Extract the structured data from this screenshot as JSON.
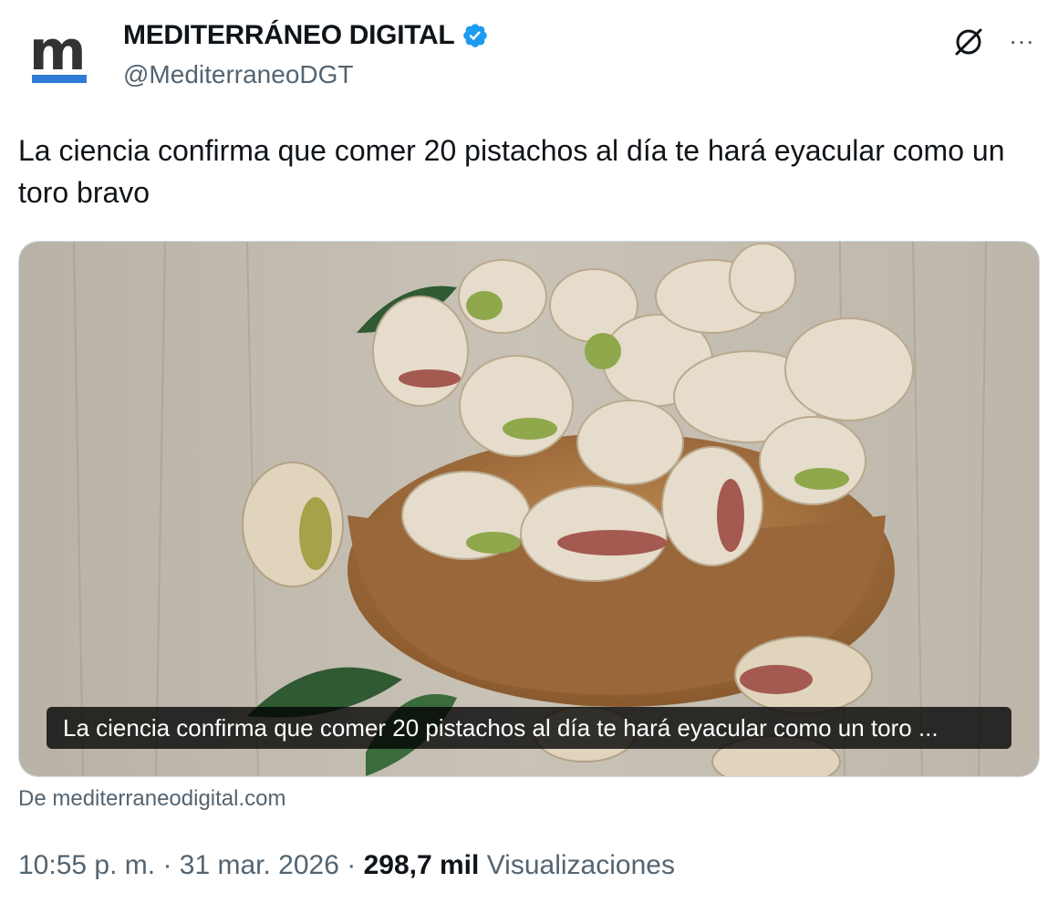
{
  "account": {
    "name": "MEDITERRÁNEO DIGITAL",
    "handle": "@MediterraneoDGT",
    "avatar_letter": "m",
    "verified_color": "#1d9bf0",
    "brand_color": "#2f7bd8"
  },
  "header_icons": [
    "grok-icon",
    "more-options-icon"
  ],
  "more_label": "···",
  "tweet": {
    "text": "La ciencia confirma que comer 20 pistachos al día te hará eyacular como un toro bravo"
  },
  "card": {
    "image_caption": "La ciencia confirma que comer 20 pistachos al día te hará eyacular como un toro ...",
    "source": "De mediterraneodigital.com"
  },
  "meta": {
    "time": "10:55 p. m.",
    "separator": "·",
    "date": "31 mar. 2026",
    "views_count": "298,7 mil",
    "views_label": "Visualizaciones"
  }
}
